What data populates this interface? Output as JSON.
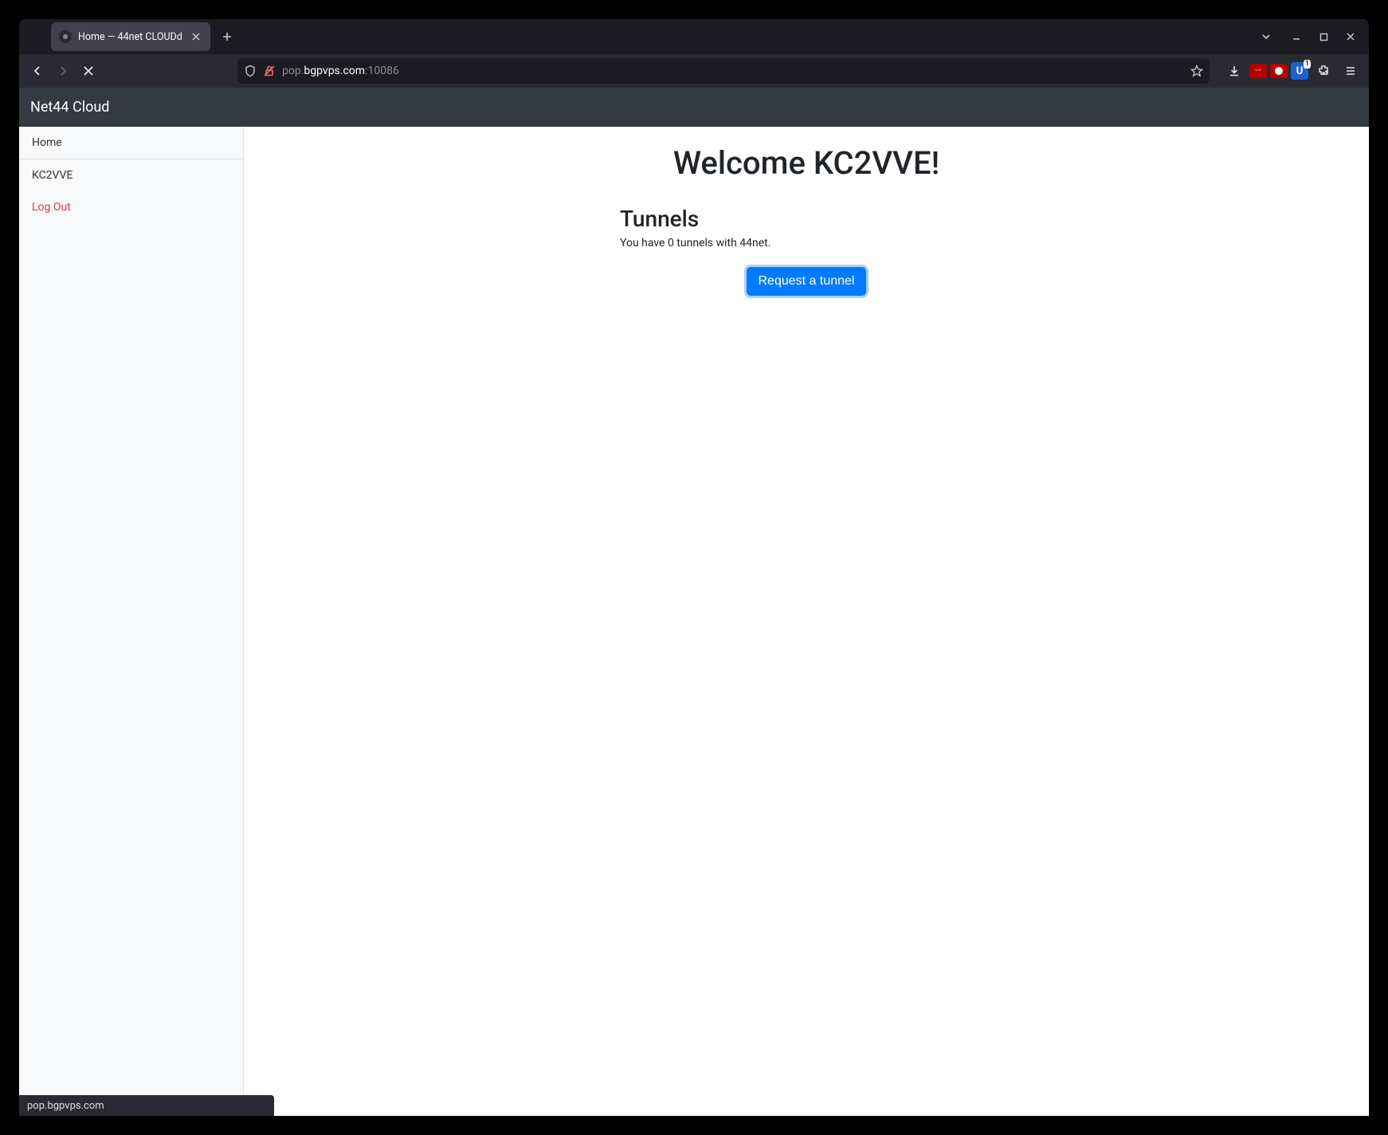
{
  "browser": {
    "tab_title": "Home — 44net CLOUDd",
    "url_host": "bgpvps.com",
    "url_prefix": "pop.",
    "url_port": ":10086",
    "status_text": "pop.bgpvps.com",
    "ext_u_badge": "1"
  },
  "app": {
    "brand": "Net44 Cloud",
    "sidebar": {
      "home": "Home",
      "callsign": "KC2VVE",
      "logout": "Log Out"
    },
    "welcome": "Welcome KC2VVE!",
    "tunnels_heading": "Tunnels",
    "tunnels_text": "You have 0 tunnels with 44net.",
    "request_button": "Request a tunnel"
  }
}
